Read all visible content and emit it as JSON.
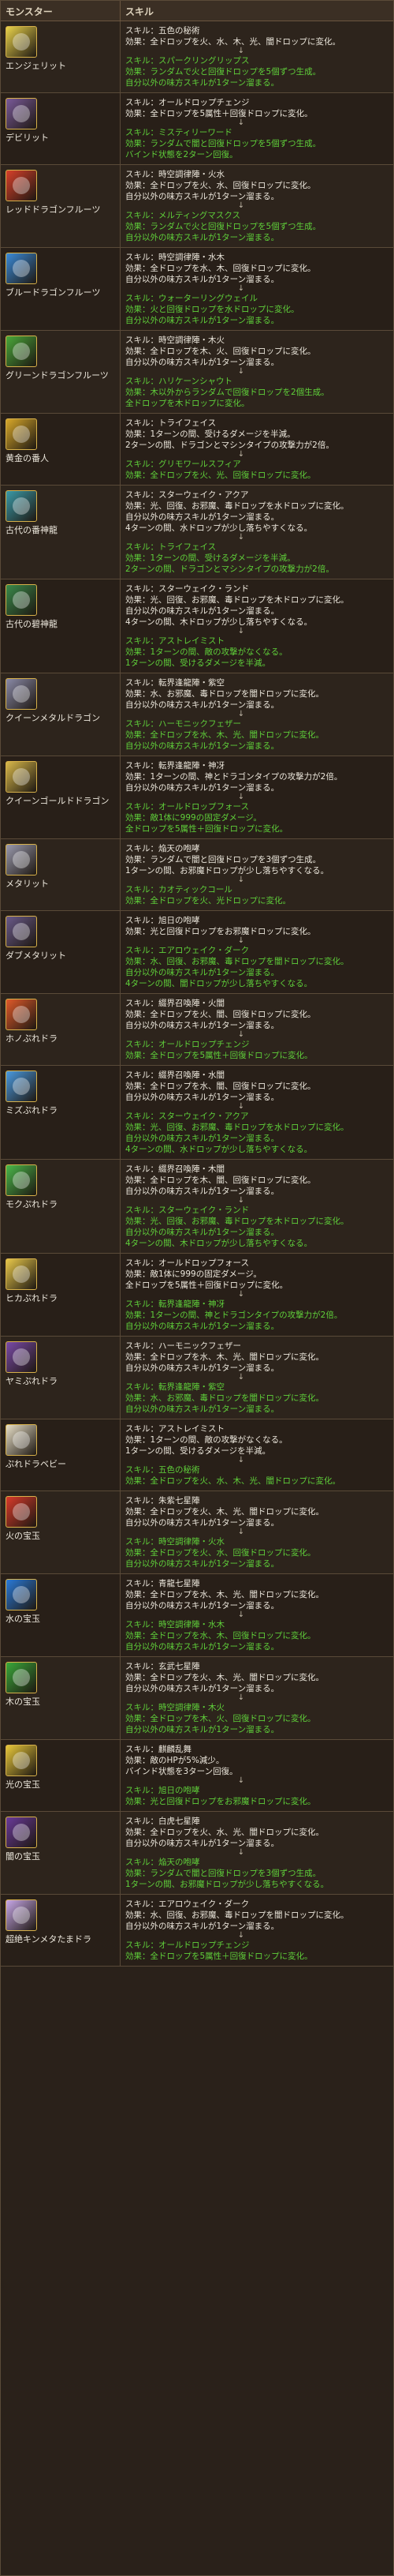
{
  "header": {
    "monster": "モンスター",
    "skill": "スキル"
  },
  "rows": [
    {
      "name": "エンジェリット",
      "color": "#e9d24a",
      "lines": [
        {
          "t": "スキル：五色の秘術"
        },
        {
          "t": "効果：全ドロップを火、水、木、光、闇ドロップに変化。"
        },
        {
          "a": 1
        },
        {
          "t": "スキル：スパークリングリップス",
          "g": 1
        },
        {
          "t": "効果：ランダムで火と回復ドロップを5個ずつ生成。",
          "g": 1
        },
        {
          "t": "自分以外の味方スキルが1ターン溜まる。",
          "g": 1
        }
      ]
    },
    {
      "name": "デビリット",
      "color": "#7a5a9a",
      "lines": [
        {
          "t": "スキル：オールドロップチェンジ"
        },
        {
          "t": "効果：全ドロップを5属性＋回復ドロップに変化。"
        },
        {
          "a": 1
        },
        {
          "t": "スキル：ミスティリーワード",
          "g": 1
        },
        {
          "t": "効果：ランダムで闇と回復ドロップを5個ずつ生成。",
          "g": 1
        },
        {
          "t": "バインド状態を2ターン回復。",
          "g": 1
        }
      ]
    },
    {
      "name": "レッドドラゴンフルーツ",
      "color": "#d8402a",
      "lines": [
        {
          "t": "スキル：時空調律陣・火水"
        },
        {
          "t": "効果：全ドロップを火、水、回復ドロップに変化。"
        },
        {
          "t": "自分以外の味方スキルが1ターン溜まる。"
        },
        {
          "a": 1
        },
        {
          "t": "スキル：メルティングマスクス",
          "g": 1
        },
        {
          "t": "効果：ランダムで火と回復ドロップを5個ずつ生成。",
          "g": 1
        },
        {
          "t": "自分以外の味方スキルが1ターン溜まる。",
          "g": 1
        }
      ]
    },
    {
      "name": "ブルードラゴンフルーツ",
      "color": "#3a8ad8",
      "lines": [
        {
          "t": "スキル：時空調律陣・水木"
        },
        {
          "t": "効果：全ドロップを水、木、回復ドロップに変化。"
        },
        {
          "t": "自分以外の味方スキルが1ターン溜まる。"
        },
        {
          "a": 1
        },
        {
          "t": "スキル：ウォーターリングウェイル",
          "g": 1
        },
        {
          "t": "効果：火と回復ドロップを水ドロップに変化。",
          "g": 1
        },
        {
          "t": "自分以外の味方スキルが1ターン溜まる。",
          "g": 1
        }
      ]
    },
    {
      "name": "グリーンドラゴンフルーツ",
      "color": "#4aa83a",
      "lines": [
        {
          "t": "スキル：時空調律陣・木火"
        },
        {
          "t": "効果：全ドロップを木、火、回復ドロップに変化。"
        },
        {
          "t": "自分以外の味方スキルが1ターン溜まる。"
        },
        {
          "a": 1
        },
        {
          "t": "スキル：ハリケーンシャウト",
          "g": 1
        },
        {
          "t": "効果：木以外からランダムで回復ドロップを2個生成。",
          "g": 1
        },
        {
          "t": "全ドロップを木ドロップに変化。",
          "g": 1
        }
      ]
    },
    {
      "name": "黄金の番人",
      "color": "#d8a82a",
      "lines": [
        {
          "t": "スキル：トライフェイス"
        },
        {
          "t": "効果：1ターンの間、受けるダメージを半減。"
        },
        {
          "t": "2ターンの間、ドラゴンとマシンタイプの攻撃力が2倍。"
        },
        {
          "a": 1
        },
        {
          "t": "スキル：グリモワールスフィア",
          "g": 1
        },
        {
          "t": "効果：全ドロップを火、光、回復ドロップに変化。",
          "g": 1
        }
      ]
    },
    {
      "name": "古代の番神龍",
      "color": "#3a9aa8",
      "lines": [
        {
          "t": "スキル：スターウェイク・アクア"
        },
        {
          "t": "効果：光、回復、お邪魔、毒ドロップを水ドロップに変化。"
        },
        {
          "t": "自分以外の味方スキルが1ターン溜まる。"
        },
        {
          "t": "4ターンの間、水ドロップが少し落ちやすくなる。"
        },
        {
          "a": 1
        },
        {
          "t": "スキル：トライフェイス",
          "g": 1
        },
        {
          "t": "効果：1ターンの間、受けるダメージを半減。",
          "g": 1
        },
        {
          "t": "2ターンの間、ドラゴンとマシンタイプの攻撃力が2倍。",
          "g": 1
        }
      ]
    },
    {
      "name": "古代の碧神龍",
      "color": "#3a8a4a",
      "lines": [
        {
          "t": "スキル：スターウェイク・ランド"
        },
        {
          "t": "効果：光、回復、お邪魔、毒ドロップを木ドロップに変化。"
        },
        {
          "t": "自分以外の味方スキルが1ターン溜まる。"
        },
        {
          "t": "4ターンの間、木ドロップが少し落ちやすくなる。"
        },
        {
          "a": 1
        },
        {
          "t": "スキル：アストレイミスト",
          "g": 1
        },
        {
          "t": "効果：1ターンの間、敵の攻撃がなくなる。",
          "g": 1
        },
        {
          "t": "1ターンの間、受けるダメージを半減。",
          "g": 1
        }
      ]
    },
    {
      "name": "クイーンメタルドラゴン",
      "color": "#8a8aa8",
      "lines": [
        {
          "t": "スキル：転界逢龍陣・紫空"
        },
        {
          "t": "効果：水、お邪魔、毒ドロップを闇ドロップに変化。"
        },
        {
          "t": "自分以外の味方スキルが1ターン溜まる。"
        },
        {
          "a": 1
        },
        {
          "t": "スキル：ハーモニックフェザー",
          "g": 1
        },
        {
          "t": "効果：全ドロップを水、木、光、闇ドロップに変化。",
          "g": 1
        },
        {
          "t": "自分以外の味方スキルが1ターン溜まる。",
          "g": 1
        }
      ]
    },
    {
      "name": "クイーンゴールドドラゴン",
      "color": "#d8b84a",
      "lines": [
        {
          "t": "スキル：転界逢龍陣・神冴"
        },
        {
          "t": "効果：1ターンの間、神とドラゴンタイプの攻撃力が2倍。"
        },
        {
          "t": "自分以外の味方スキルが1ターン溜まる。"
        },
        {
          "a": 1
        },
        {
          "t": "スキル：オールドロップフォース",
          "g": 1
        },
        {
          "t": "効果：敵1体に999の固定ダメージ。",
          "g": 1
        },
        {
          "t": "全ドロップを5属性＋回復ドロップに変化。",
          "g": 1
        }
      ]
    },
    {
      "name": "メタリット",
      "color": "#9a9aae",
      "lines": [
        {
          "t": "スキル：焔天の咆哮"
        },
        {
          "t": "効果：ランダムで闇と回復ドロップを3個ずつ生成。"
        },
        {
          "t": "1ターンの間、お邪魔ドロップが少し落ちやすくなる。"
        },
        {
          "a": 1
        },
        {
          "t": "スキル：カオティックコール",
          "g": 1
        },
        {
          "t": "効果：全ドロップを火、光ドロップに変化。",
          "g": 1
        }
      ]
    },
    {
      "name": "ダブメタリット",
      "color": "#6a5a8a",
      "lines": [
        {
          "t": "スキル：旭日の咆哮"
        },
        {
          "t": "効果：光と回復ドロップをお邪魔ドロップに変化。"
        },
        {
          "a": 1
        },
        {
          "t": "スキル：エアロウェイク・ダーク",
          "g": 1
        },
        {
          "t": "効果：水、回復、お邪魔、毒ドロップを闇ドロップに変化。",
          "g": 1
        },
        {
          "t": "自分以外の味方スキルが1ターン溜まる。",
          "g": 1
        },
        {
          "t": "4ターンの間、闇ドロップが少し落ちやすくなる。",
          "g": 1
        }
      ]
    },
    {
      "name": "ホノぷれドラ",
      "color": "#e05a2a",
      "lines": [
        {
          "t": "スキル：綴界召喚陣・火闇"
        },
        {
          "t": "効果：全ドロップを火、闇、回復ドロップに変化。"
        },
        {
          "t": "自分以外の味方スキルが1ターン溜まる。"
        },
        {
          "a": 1
        },
        {
          "t": "スキル：オールドロップチェンジ",
          "g": 1
        },
        {
          "t": "効果：全ドロップを5属性＋回復ドロップに変化。",
          "g": 1
        }
      ]
    },
    {
      "name": "ミズぷれドラ",
      "color": "#4a9ae0",
      "lines": [
        {
          "t": "スキル：綴界召喚陣・水闇"
        },
        {
          "t": "効果：全ドロップを水、闇、回復ドロップに変化。"
        },
        {
          "t": "自分以外の味方スキルが1ターン溜まる。"
        },
        {
          "a": 1
        },
        {
          "t": "スキル：スターウェイク・アクア",
          "g": 1
        },
        {
          "t": "効果：光、回復、お邪魔、毒ドロップを水ドロップに変化。",
          "g": 1
        },
        {
          "t": "自分以外の味方スキルが1ターン溜まる。",
          "g": 1
        },
        {
          "t": "4ターンの間、水ドロップが少し落ちやすくなる。",
          "g": 1
        }
      ]
    },
    {
      "name": "モクぷれドラ",
      "color": "#4ab84a",
      "lines": [
        {
          "t": "スキル：綴界召喚陣・木闇"
        },
        {
          "t": "効果：全ドロップを木、闇、回復ドロップに変化。"
        },
        {
          "t": "自分以外の味方スキルが1ターン溜まる。"
        },
        {
          "a": 1
        },
        {
          "t": "スキル：スターウェイク・ランド",
          "g": 1
        },
        {
          "t": "効果：光、回復、お邪魔、毒ドロップを木ドロップに変化。",
          "g": 1
        },
        {
          "t": "自分以外の味方スキルが1ターン溜まる。",
          "g": 1
        },
        {
          "t": "4ターンの間、木ドロップが少し落ちやすくなる。",
          "g": 1
        }
      ]
    },
    {
      "name": "ヒカぷれドラ",
      "color": "#e8c84a",
      "lines": [
        {
          "t": "スキル：オールドロップフォース"
        },
        {
          "t": "効果：敵1体に999の固定ダメージ。"
        },
        {
          "t": "全ドロップを5属性＋回復ドロップに変化。"
        },
        {
          "a": 1
        },
        {
          "t": "スキル：転界逢龍陣・神冴",
          "g": 1
        },
        {
          "t": "効果：1ターンの間、神とドラゴンタイプの攻撃力が2倍。",
          "g": 1
        },
        {
          "t": "自分以外の味方スキルが1ターン溜まる。",
          "g": 1
        }
      ]
    },
    {
      "name": "ヤミぷれドラ",
      "color": "#7a4aa8",
      "lines": [
        {
          "t": "スキル：ハーモニックフェザー"
        },
        {
          "t": "効果：全ドロップを水、木、光、闇ドロップに変化。"
        },
        {
          "t": "自分以外の味方スキルが1ターン溜まる。"
        },
        {
          "a": 1
        },
        {
          "t": "スキル：転界逢龍陣・紫空",
          "g": 1
        },
        {
          "t": "効果：水、お邪魔、毒ドロップを闇ドロップに変化。",
          "g": 1
        },
        {
          "t": "自分以外の味方スキルが1ターン溜まる。",
          "g": 1
        }
      ]
    },
    {
      "name": "ぷれドラベビー",
      "color": "#e8e0c8",
      "lines": [
        {
          "t": "スキル：アストレイミスト"
        },
        {
          "t": "効果：1ターンの間、敵の攻撃がなくなる。"
        },
        {
          "t": "1ターンの間、受けるダメージを半減。"
        },
        {
          "a": 1
        },
        {
          "t": "スキル：五色の秘術",
          "g": 1
        },
        {
          "t": "効果：全ドロップを火、水、木、光、闇ドロップに変化。",
          "g": 1
        }
      ]
    },
    {
      "name": "火の宝玉",
      "color": "#d83a2a",
      "lines": [
        {
          "t": "スキル：朱紫七星陣"
        },
        {
          "t": "効果：全ドロップを火、木、光、闇ドロップに変化。"
        },
        {
          "t": "自分以外の味方スキルが1ターン溜まる。"
        },
        {
          "a": 1
        },
        {
          "t": "スキル：時空調律陣・火水",
          "g": 1
        },
        {
          "t": "効果：全ドロップを火、水、回復ドロップに変化。",
          "g": 1
        },
        {
          "t": "自分以外の味方スキルが1ターン溜まる。",
          "g": 1
        }
      ]
    },
    {
      "name": "水の宝玉",
      "color": "#2a7ad8",
      "lines": [
        {
          "t": "スキル：青龍七星陣"
        },
        {
          "t": "効果：全ドロップを水、木、光、闇ドロップに変化。"
        },
        {
          "t": "自分以外の味方スキルが1ターン溜まる。"
        },
        {
          "a": 1
        },
        {
          "t": "スキル：時空調律陣・水木",
          "g": 1
        },
        {
          "t": "効果：全ドロップを水、木、回復ドロップに変化。",
          "g": 1
        },
        {
          "t": "自分以外の味方スキルが1ターン溜まる。",
          "g": 1
        }
      ]
    },
    {
      "name": "木の宝玉",
      "color": "#3aa83a",
      "lines": [
        {
          "t": "スキル：玄武七星陣"
        },
        {
          "t": "効果：全ドロップを火、木、光、闇ドロップに変化。"
        },
        {
          "t": "自分以外の味方スキルが1ターン溜まる。"
        },
        {
          "a": 1
        },
        {
          "t": "スキル：時空調律陣・木火",
          "g": 1
        },
        {
          "t": "効果：全ドロップを木、火、回復ドロップに変化。",
          "g": 1
        },
        {
          "t": "自分以外の味方スキルが1ターン溜まる。",
          "g": 1
        }
      ]
    },
    {
      "name": "光の宝玉",
      "color": "#e8c83a",
      "lines": [
        {
          "t": "スキル：麒麟乱舞"
        },
        {
          "t": "効果：敵のHPが5%減少。"
        },
        {
          "t": "バインド状態を3ターン回復。"
        },
        {
          "a": 1
        },
        {
          "t": "スキル：旭日の咆哮",
          "g": 1
        },
        {
          "t": "効果：光と回復ドロップをお邪魔ドロップに変化。",
          "g": 1
        }
      ]
    },
    {
      "name": "闇の宝玉",
      "color": "#6a3a9a",
      "lines": [
        {
          "t": "スキル：白虎七星陣"
        },
        {
          "t": "効果：全ドロップを火、水、光、闇ドロップに変化。"
        },
        {
          "t": "自分以外の味方スキルが1ターン溜まる。"
        },
        {
          "a": 1
        },
        {
          "t": "スキル：焔天の咆哮",
          "g": 1
        },
        {
          "t": "効果：ランダムで闇と回復ドロップを3個ずつ生成。",
          "g": 1
        },
        {
          "t": "1ターンの間、お邪魔ドロップが少し落ちやすくなる。",
          "g": 1
        }
      ]
    },
    {
      "name": "超絶キンメタたまドラ",
      "color": "#c8a8e8",
      "lines": [
        {
          "t": "スキル：エアロウェイク・ダーク"
        },
        {
          "t": "効果：水、回復、お邪魔、毒ドロップを闇ドロップに変化。"
        },
        {
          "t": "自分以外の味方スキルが1ターン溜まる。"
        },
        {
          "a": 1
        },
        {
          "t": "スキル：オールドロップチェンジ",
          "g": 1
        },
        {
          "t": "効果：全ドロップを5属性＋回復ドロップに変化。",
          "g": 1
        }
      ]
    }
  ]
}
